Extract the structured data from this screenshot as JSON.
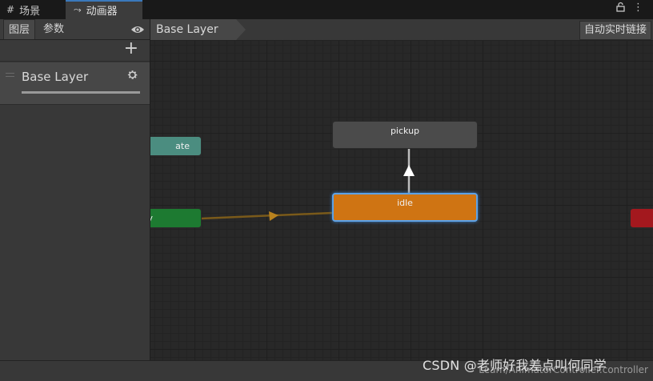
{
  "window_tabs": [
    {
      "icon": "#",
      "label": "场景"
    },
    {
      "icon": "⤳",
      "label": "动画器"
    }
  ],
  "window_controls": {
    "lock": "🔒",
    "menu": "⋮"
  },
  "left_panel": {
    "tabs": [
      "图层",
      "参数"
    ],
    "add_symbol": "+",
    "layers": [
      {
        "name": "Base Layer"
      }
    ]
  },
  "breadcrumb": {
    "item": "Base Layer"
  },
  "auto_live_link": "自动实时链接",
  "states": {
    "pickup": "pickup",
    "idle": "idle",
    "any_state": "ate",
    "entry": "y",
    "exit": ""
  },
  "colors": {
    "default_state": "#4b4b4b",
    "default_layer_state": "#cf7413",
    "any_state": "#4b8d80",
    "entry": "#1d7a31",
    "exit": "#a3181e",
    "selection": "#5ea2e6"
  },
  "footer": {
    "file_path": "Learn/AnimatorController.controller",
    "watermark": "CSDN @老师好我差点叫何同学"
  }
}
